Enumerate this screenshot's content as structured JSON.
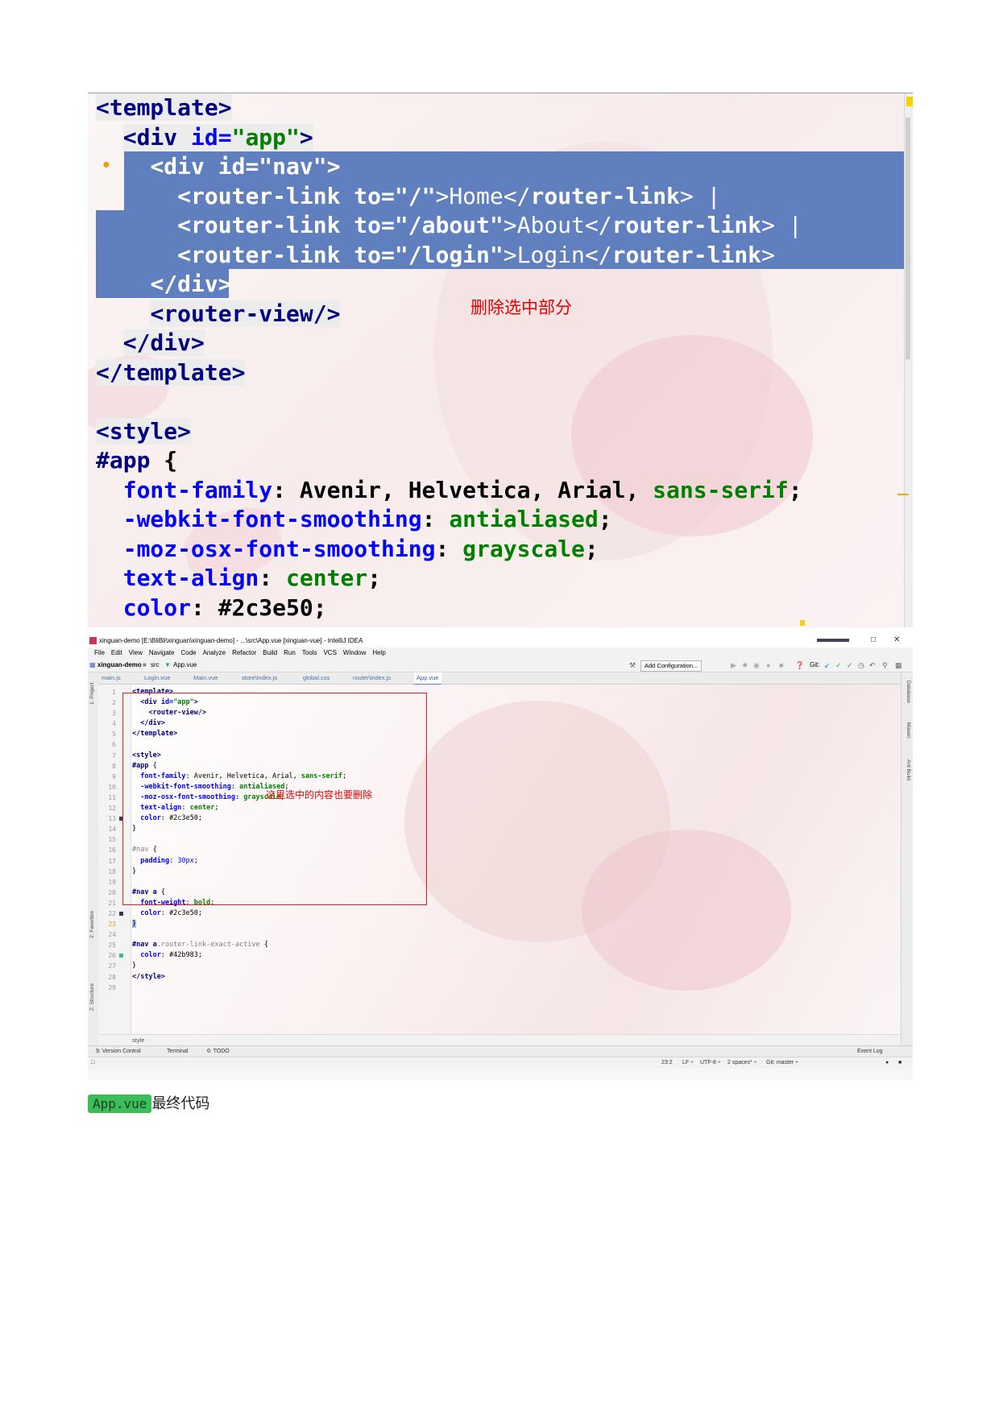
{
  "zoomed_code": {
    "template_open": "<template>",
    "div_app_prefix": "<div ",
    "div_app_attr": "id=",
    "div_app_val": "\"app\"",
    "div_app_close": ">",
    "nav_line": "<div id=\"nav\">",
    "link_home_tag": "<router-link",
    "link_home_attr": " to=",
    "link_home_val": "\"/\"",
    "link_home_text": ">Home</",
    "link_home_close": "router-link",
    "link_home_end": "> |",
    "link_about_tag": "<router-link",
    "link_about_attr": " to=",
    "link_about_val": "\"/about\"",
    "link_about_text": ">About</",
    "link_about_close": "router-link",
    "link_about_end": "> |",
    "link_login_tag": "<router-link",
    "link_login_attr": " to=",
    "link_login_val": "\"/login\"",
    "link_login_text": ">Login</",
    "link_login_close": "router-link",
    "link_login_end": ">",
    "nav_close": "</div>",
    "router_view": "<router-view/>",
    "div_close": "</div>",
    "template_close": "</template>",
    "style_open": "<style>",
    "app_selector": "#app",
    "brace_open": " {",
    "ff_prop": "font-family",
    "ff_val": ": Avenir, Helvetica, Arial, ",
    "ff_val2": "sans-serif",
    "semi": ";",
    "webkit_prop": "-webkit-font-smoothing",
    "webkit_val": "antialiased",
    "moz_prop": "-moz-osx-font-smoothing",
    "moz_val": "grayscale",
    "ta_prop": "text-align",
    "ta_val": "center",
    "color_prop": "color",
    "color_val": ": #2c3e50;",
    "colon": ": ",
    "annotation": "删除选中部分"
  },
  "ide": {
    "window_title": "xinguan-demo [E:\\BliBli\\xinguan\\xinguan-demo] - ...\\src\\App.vue [xinguan-vue] - IntelliJ IDEA",
    "menu": [
      "File",
      "Edit",
      "View",
      "Navigate",
      "Code",
      "Analyze",
      "Refactor",
      "Build",
      "Run",
      "Tools",
      "VCS",
      "Window",
      "Help"
    ],
    "breadcrumb_project": "xinguan-demo",
    "breadcrumb_src": "src",
    "breadcrumb_file": "App.vue",
    "add_config": "Add Configuration...",
    "git_label": "Git:",
    "tabs": [
      "main.js",
      "Login.vue",
      "Main.vue",
      "store\\index.js",
      "global.css",
      "router\\index.js",
      "App.vue"
    ],
    "left_tools": [
      "1: Project",
      "2: Favorites",
      "Z: Structure"
    ],
    "right_tools": [
      "Database",
      "Maven",
      "Ant Build"
    ],
    "line_numbers": [
      "1",
      "2",
      "3",
      "4",
      "5",
      "6",
      "7",
      "8",
      "9",
      "10",
      "11",
      "12",
      "13",
      "14",
      "15",
      "16",
      "17",
      "18",
      "19",
      "20",
      "21",
      "22",
      "23",
      "24",
      "25",
      "26",
      "27",
      "28",
      "29"
    ],
    "code": {
      "l1": "<template>",
      "l2a": "  <div ",
      "l2b": "id=",
      "l2c": "\"app\"",
      "l2d": ">",
      "l3": "    <router-view/>",
      "l4": "  </div>",
      "l5": "</template>",
      "l7": "<style>",
      "l8a": "#app",
      "l8b": " {",
      "l9a": "  font-family",
      "l9b": ": Avenir, Helvetica, Arial, ",
      "l9c": "sans-serif",
      "l9d": ";",
      "l10a": "  -webkit-font-smoothing",
      "l10b": ": ",
      "l10c": "antialiased",
      "l10d": ";",
      "l11a": "  -moz-osx-font-smoothing",
      "l11b": ": ",
      "l11c": "grayscale",
      "l11d": ";",
      "l12a": "  text-align",
      "l12b": ": ",
      "l12c": "center",
      "l12d": ";",
      "l13a": "  color",
      "l13b": ": #2c3e50;",
      "l14": "}",
      "l16a": "#nav",
      "l16b": " {",
      "l17a": "  padding",
      "l17b": ": ",
      "l17c": "30px",
      "l17d": ";",
      "l18": "}",
      "l20a": "#nav a",
      "l20b": " {",
      "l21a": "  font-weight",
      "l21b": ": ",
      "l21c": "bold",
      "l21d": ";",
      "l22a": "  color",
      "l22b": ": #2c3e50;",
      "l23": "}",
      "l25a": "#nav a",
      "l25b": ".router-link-exact-active",
      "l25c": " {",
      "l26a": "  color",
      "l26b": ": #42b983;",
      "l27": "}",
      "l28": "</style>"
    },
    "gutter_colors": {
      "l13": "#2c3e50",
      "l22": "#2c3e50",
      "l26": "#42b983"
    },
    "annotation": "这里选中的内容也要删除",
    "crumb_bottom": "style",
    "tool_windows": [
      "9: Version Control",
      "Terminal",
      "6: TODO"
    ],
    "event_log": "Event Log",
    "status": {
      "position": "23:2",
      "line_sep": "LF ÷",
      "encoding": "UTF-8 ÷",
      "indent": "2 spaces* ÷",
      "git": "Git: master ÷"
    }
  },
  "caption": {
    "chip": "App.vue",
    "text": "最终代码"
  }
}
